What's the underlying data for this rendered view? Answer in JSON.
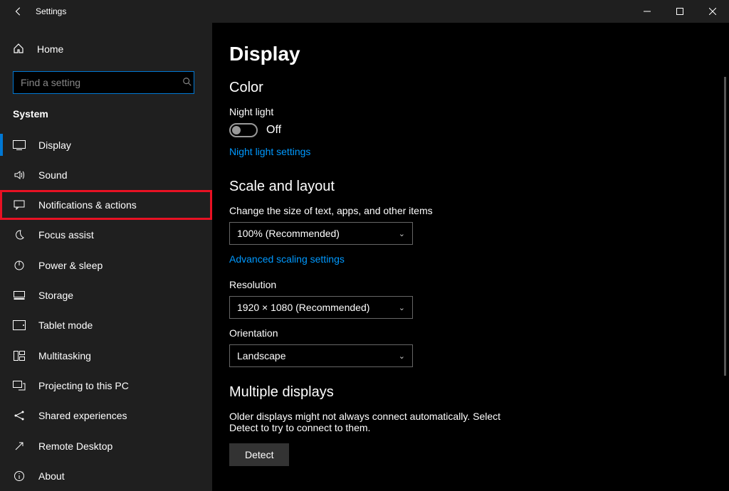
{
  "titlebar": {
    "title": "Settings"
  },
  "sidebar": {
    "home": "Home",
    "search_placeholder": "Find a setting",
    "section": "System",
    "items": [
      {
        "label": "Display",
        "icon": "display"
      },
      {
        "label": "Sound",
        "icon": "sound"
      },
      {
        "label": "Notifications & actions",
        "icon": "message"
      },
      {
        "label": "Focus assist",
        "icon": "moon"
      },
      {
        "label": "Power & sleep",
        "icon": "power"
      },
      {
        "label": "Storage",
        "icon": "storage"
      },
      {
        "label": "Tablet mode",
        "icon": "tablet"
      },
      {
        "label": "Multitasking",
        "icon": "multitask"
      },
      {
        "label": "Projecting to this PC",
        "icon": "project"
      },
      {
        "label": "Shared experiences",
        "icon": "share"
      },
      {
        "label": "Remote Desktop",
        "icon": "remote"
      },
      {
        "label": "About",
        "icon": "info"
      }
    ]
  },
  "content": {
    "page_title": "Display",
    "color_section": "Color",
    "night_light_label": "Night light",
    "night_light_state": "Off",
    "night_light_link": "Night light settings",
    "scale_section": "Scale and layout",
    "scale_label": "Change the size of text, apps, and other items",
    "scale_value": "100% (Recommended)",
    "advanced_link": "Advanced scaling settings",
    "resolution_label": "Resolution",
    "resolution_value": "1920 × 1080 (Recommended)",
    "orientation_label": "Orientation",
    "orientation_value": "Landscape",
    "multi_section": "Multiple displays",
    "multi_desc": "Older displays might not always connect automatically. Select Detect to try to connect to them.",
    "detect_btn": "Detect"
  }
}
